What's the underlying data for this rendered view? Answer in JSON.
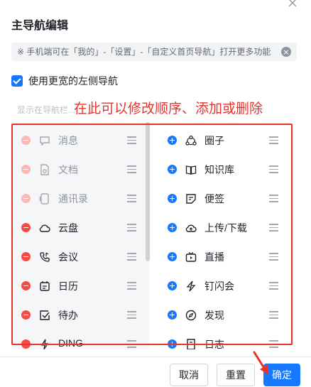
{
  "dialog": {
    "title": "主导航编辑",
    "tip": "※ 手机端可在「我的」-「设置」-「自定义首页导航」打开更多功能",
    "wide_nav_label": "使用更宽的左侧导航",
    "section_label": "显示在导航栏...",
    "annotation": "在此可以修改顺序、添加或删除"
  },
  "shown_items": [
    {
      "label": "消息",
      "icon": "message-icon",
      "locked": true
    },
    {
      "label": "文档",
      "icon": "document-icon",
      "locked": true
    },
    {
      "label": "通讯录",
      "icon": "contacts-icon",
      "locked": true
    },
    {
      "label": "云盘",
      "icon": "cloud-icon",
      "locked": false
    },
    {
      "label": "会议",
      "icon": "phone-icon",
      "locked": false
    },
    {
      "label": "日历",
      "icon": "calendar-icon",
      "locked": false
    },
    {
      "label": "待办",
      "icon": "todo-icon",
      "locked": false
    },
    {
      "label": "DING",
      "icon": "ding-icon",
      "locked": false
    }
  ],
  "more_items": [
    {
      "label": "圈子",
      "icon": "circle-group-icon"
    },
    {
      "label": "知识库",
      "icon": "book-icon"
    },
    {
      "label": "便签",
      "icon": "note-icon"
    },
    {
      "label": "上传/下载",
      "icon": "upload-cloud-icon"
    },
    {
      "label": "直播",
      "icon": "tv-icon"
    },
    {
      "label": "钉闪会",
      "icon": "lightning-icon"
    },
    {
      "label": "发现",
      "icon": "compass-icon"
    },
    {
      "label": "日志",
      "icon": "log-icon"
    }
  ],
  "footer": {
    "cancel": "取消",
    "reset": "重置",
    "confirm": "确定"
  },
  "colors": {
    "primary": "#1677ff",
    "remove": "#f54a45",
    "annotation": "#e8332d"
  }
}
